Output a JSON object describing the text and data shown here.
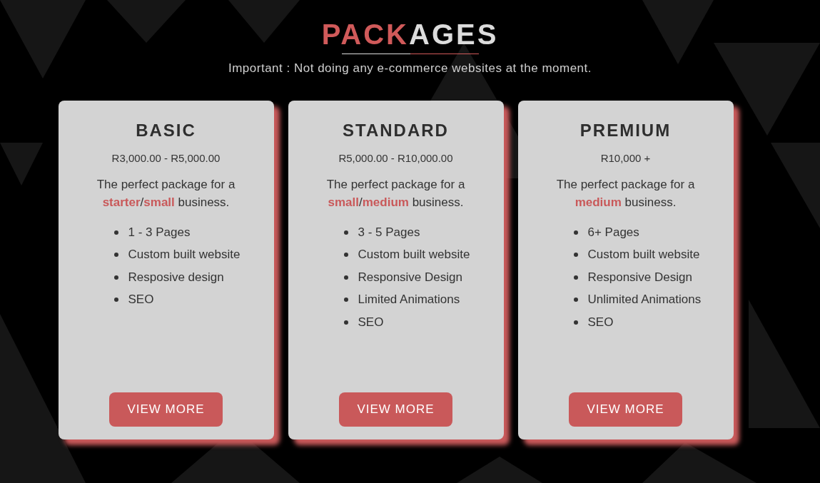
{
  "heading": {
    "parts": [
      {
        "text": "PACK",
        "accent": true
      },
      {
        "text": "AGES",
        "accent": false
      }
    ]
  },
  "notice": "Important : Not doing any e-commerce websites at the moment.",
  "packages": [
    {
      "name": "BASIC",
      "price": "R3,000.00 - R5,000.00",
      "description": "The perfect package for a **starter**/**small** business.",
      "features": [
        "1 - 3 Pages",
        "Custom built website",
        "Resposive design",
        "SEO"
      ],
      "button": "VIEW MORE"
    },
    {
      "name": "STANDARD",
      "price": "R5,000.00 - R10,000.00",
      "description": "The perfect package for a **small**/**medium** business.",
      "features": [
        "3 - 5 Pages",
        "Custom built website",
        "Responsive Design",
        "Limited Animations",
        "SEO"
      ],
      "button": "VIEW MORE"
    },
    {
      "name": "PREMIUM",
      "price": "R10,000 +",
      "description": "The perfect package for a **medium** business.",
      "features": [
        "6+ Pages",
        "Custom built website",
        "Responsive Design",
        "Unlimited Animations",
        "SEO"
      ],
      "button": "VIEW MORE"
    }
  ]
}
